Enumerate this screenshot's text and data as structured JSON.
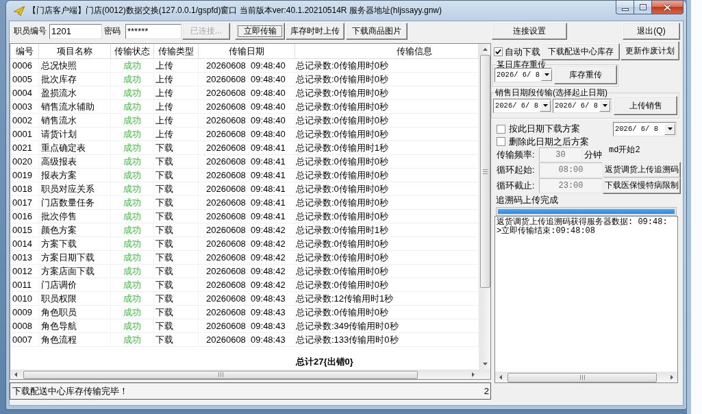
{
  "window": {
    "title": "【门店客户端】门店(0012)数据交换(127.0.0.1/gspfd)窗口 当前版本ver:40.1.20210514R 服务器地址(hljssayy.gnw)"
  },
  "toolbar": {
    "fields": [
      {
        "label": "职员编号",
        "value": "1201"
      },
      {
        "label": "密码",
        "value": "******"
      }
    ],
    "buttons": [
      {
        "label": "已连接...",
        "disabled": true,
        "focused": false
      },
      {
        "label": "立即传输",
        "disabled": false,
        "focused": true
      },
      {
        "label": "库存时时上传",
        "disabled": false,
        "focused": false
      },
      {
        "label": "下载商品图片",
        "disabled": false,
        "focused": false
      },
      {
        "label": "连接设置",
        "disabled": false,
        "focused": false
      },
      {
        "label": "退出(Q)",
        "disabled": false,
        "focused": false
      }
    ]
  },
  "table": {
    "columns": [
      "编号",
      "项目名称",
      "传输状态",
      "传输类型",
      "传输日期",
      "传输信息"
    ],
    "rows": [
      {
        "id": "0006",
        "name": "总况快照",
        "status": "成功",
        "success": true,
        "type": "上传",
        "date": "20260608  09:48:40",
        "info": "总记录数:0传输用时0秒"
      },
      {
        "id": "0005",
        "name": "批次库存",
        "status": "成功",
        "success": true,
        "type": "上传",
        "date": "20260608  09:48:40",
        "info": "总记录数:0传输用时0秒"
      },
      {
        "id": "0004",
        "name": "盈损流水",
        "status": "成功",
        "success": true,
        "type": "上传",
        "date": "20260608  09:48:40",
        "info": "总记录数:0传输用时0秒"
      },
      {
        "id": "0003",
        "name": "销售流水辅助",
        "status": "成功",
        "success": true,
        "type": "上传",
        "date": "20260608  09:48:40",
        "info": "总记录数:0传输用时0秒"
      },
      {
        "id": "0002",
        "name": "销售流水",
        "status": "成功",
        "success": true,
        "type": "上传",
        "date": "20260608  09:48:40",
        "info": "总记录数:0传输用时0秒"
      },
      {
        "id": "0001",
        "name": "请货计划",
        "status": "成功",
        "success": true,
        "type": "上传",
        "date": "20260608  09:48:40",
        "info": "总记录数:0传输用时0秒"
      },
      {
        "id": "0021",
        "name": "重点确定表",
        "status": "成功",
        "success": true,
        "type": "下载",
        "date": "20260608  09:48:41",
        "info": "总记录数:0传输用时1秒"
      },
      {
        "id": "0020",
        "name": "高级报表",
        "status": "成功",
        "success": true,
        "type": "下载",
        "date": "20260608  09:48:41",
        "info": "总记录数:0传输用时0秒"
      },
      {
        "id": "0019",
        "name": "报表方案",
        "status": "成功",
        "success": true,
        "type": "下载",
        "date": "20260608  09:48:41",
        "info": "总记录数:0传输用时0秒"
      },
      {
        "id": "0018",
        "name": "职员对应关系",
        "status": "成功",
        "success": true,
        "type": "下载",
        "date": "20260608  09:48:41",
        "info": "总记录数:0传输用时0秒"
      },
      {
        "id": "0017",
        "name": "门店数量任务",
        "status": "成功",
        "success": true,
        "type": "下载",
        "date": "20260608  09:48:41",
        "info": "总记录数:0传输用时0秒"
      },
      {
        "id": "0016",
        "name": "批次停售",
        "status": "成功",
        "success": true,
        "type": "下载",
        "date": "20260608  09:48:41",
        "info": "总记录数:0传输用时0秒"
      },
      {
        "id": "0015",
        "name": "颜色方案",
        "status": "成功",
        "success": true,
        "type": "下载",
        "date": "20260608  09:48:42",
        "info": "总记录数:0传输用时1秒"
      },
      {
        "id": "0014",
        "name": "方案下载",
        "status": "成功",
        "success": true,
        "type": "下载",
        "date": "20260608  09:48:42",
        "info": "总记录数:0传输用时0秒"
      },
      {
        "id": "0013",
        "name": "方案日期下载",
        "status": "成功",
        "success": true,
        "type": "下载",
        "date": "20260608  09:48:42",
        "info": "总记录数:0传输用时0秒"
      },
      {
        "id": "0012",
        "name": "方案店面下载",
        "status": "成功",
        "success": true,
        "type": "下载",
        "date": "20260608  09:48:42",
        "info": "总记录数:0传输用时0秒"
      },
      {
        "id": "0011",
        "name": "门店调价",
        "status": "成功",
        "success": true,
        "type": "下载",
        "date": "20260608  09:48:42",
        "info": "总记录数:0传输用时0秒"
      },
      {
        "id": "0010",
        "name": "职员权限",
        "status": "成功",
        "success": true,
        "type": "下载",
        "date": "20260608  09:48:43",
        "info": "总记录数:12传输用时1秒"
      },
      {
        "id": "0009",
        "name": "角色职员",
        "status": "成功",
        "success": true,
        "type": "下载",
        "date": "20260608  09:48:43",
        "info": "总记录数:0传输用时0秒"
      },
      {
        "id": "0008",
        "name": "角色导航",
        "status": "成功",
        "success": true,
        "type": "下载",
        "date": "20260608  09:48:43",
        "info": "总记录数:349传输用时0秒"
      },
      {
        "id": "0007",
        "name": "角色流程",
        "status": "成功",
        "success": true,
        "type": "下载",
        "date": "20260608  09:48:43",
        "info": "总记录数:133传输用时0秒"
      }
    ],
    "total": "总计27{出错0}"
  },
  "status_bar": {
    "message": "下载配送中心库存传输完毕！",
    "count": "2"
  },
  "right_panel": {
    "auto_download": {
      "label": "自动下载",
      "checked": true
    },
    "buttons": [
      "下载配送中心库存",
      "更新作废计划"
    ],
    "stock_resend": {
      "title": "某日库存重传",
      "date": "2026/ 6/ 8",
      "button": "库存重传"
    },
    "sales_range": {
      "title": "销售日期段传输(选择起止日期)",
      "start_date": "2026/ 6/ 8",
      "end_date": "2026/ 6/ 8",
      "button": "上传销售"
    },
    "plan_options": [
      {
        "label": "按此日期下载方案",
        "checked": false
      },
      {
        "label": "删除此日期之后方案",
        "checked": false
      }
    ],
    "plan_date": "2026/ 6/ 8",
    "note": "md开始2",
    "schedule": [
      {
        "label": "传输频率:",
        "value": "30",
        "unit": "分钟",
        "disabled": true
      },
      {
        "label": "循环起始:",
        "value": "08:00",
        "disabled": true
      },
      {
        "label": "循环截止:",
        "value": "23:00",
        "disabled": true
      }
    ],
    "side_buttons": [
      "返货调货上传追溯码",
      "下载医保慢特病限制"
    ],
    "upload_status": "追溯码上传完成",
    "progress": {
      "level": 1
    },
    "log": [
      "返货调货上传追溯码获得服务器数据: 09:48:",
      ">立即传输结束:09:48:08"
    ]
  }
}
